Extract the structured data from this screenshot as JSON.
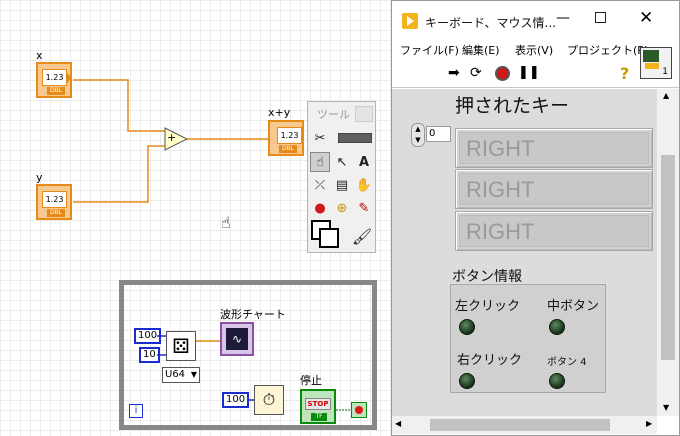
{
  "block_diagram": {
    "x_label": "x",
    "y_label": "y",
    "sum_label": "x+y",
    "terminal_text": "1.23",
    "terminal_type": "DBL",
    "add_symbol": "+",
    "cursor_icon": "hand-cursor-icon"
  },
  "tools_palette": {
    "title": "ツール"
  },
  "loop": {
    "const_100": "100",
    "const_10": "10",
    "const_wait": "100",
    "rep_type": "U64",
    "chart_label": "波形チャート",
    "stop_label": "停止",
    "stop_text": "STOP",
    "stop_type": "TF",
    "iteration": "i"
  },
  "window": {
    "title": "キーボード、マウス情...",
    "menu": [
      "ファイル(F)",
      "編集(E)",
      "表示(V)",
      "プロジェクト(P)"
    ],
    "help_icon": "?",
    "vi_icon_number": "1",
    "accent": "#f4b31a"
  },
  "front_panel": {
    "title": "押されたキー",
    "index_value": "0",
    "keys": [
      "RIGHT",
      "RIGHT",
      "RIGHT"
    ],
    "button_info_label": "ボタン情報",
    "buttons": {
      "left": "左クリック",
      "middle": "中ボタン",
      "right": "右クリック",
      "button4": "ボタン 4"
    }
  }
}
